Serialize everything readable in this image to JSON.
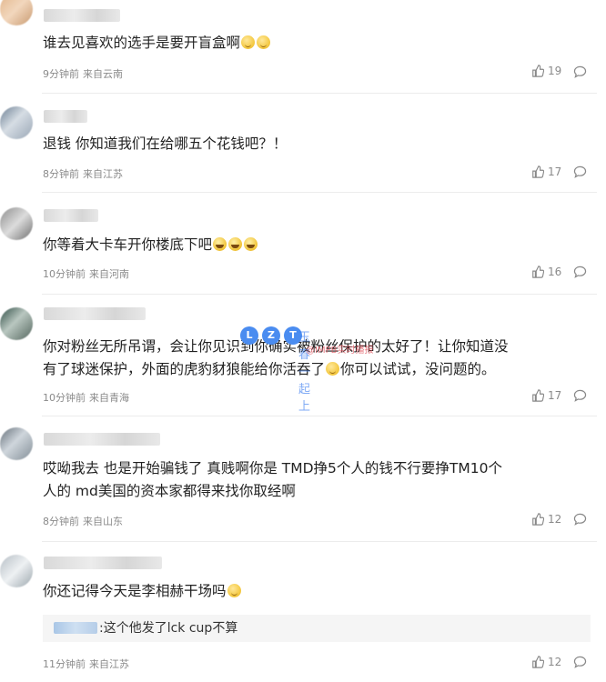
{
  "comments": [
    {
      "text": "谁去见喜欢的选手是要开盲盒啊",
      "emojis": [
        "smile",
        "smile"
      ],
      "time": "9分钟前",
      "location": "来自云南",
      "likes": "19"
    },
    {
      "text": "退钱 你知道我们在给哪五个花钱吧？！",
      "emojis": [],
      "time": "8分钟前",
      "location": "来自江苏",
      "likes": "17"
    },
    {
      "text": "你等着大卡车开你楼底下吧",
      "emojis": [
        "laugh",
        "laugh",
        "laugh"
      ],
      "time": "10分钟前",
      "location": "来自河南",
      "likes": "16"
    },
    {
      "text_line1": "你对粉丝无所吊谓，会让你见识到你确实被粉丝保护的太好了！让你知道没",
      "text_line2_a": "有了球迷保护，外面的虎豹豺狼能给你活吞了",
      "text_line2_b": "你可以试试，没问题的。",
      "time": "10分钟前",
      "location": "来自青海",
      "likes": "17"
    },
    {
      "text_line1": "哎呦我去 也是开始骗钱了 真贱啊你是 TMD挣5个人的钱不行要挣TM10个",
      "text_line2": "人的 md美国的资本家都得来找你取经啊",
      "time": "8分钟前",
      "location": "来自山东",
      "likes": "12"
    },
    {
      "text": "你还记得今天是李相赫干场吗",
      "sub_reply": ":这个他发了lck cup不算",
      "time": "11分钟前",
      "location": "来自江苏",
      "likes": "12"
    }
  ],
  "watermark": {
    "badge1": "L",
    "badge2": "Z",
    "badge3": "T",
    "text": "玉春一起上",
    "sub": "@IMPB实时播报"
  },
  "icons": {
    "like": "thumbs-up-icon",
    "reply": "comment-bubble-icon"
  },
  "colors": {
    "meta": "#8a8a8a",
    "text": "#222222",
    "divider": "#ececec",
    "subreply_bg": "#f5f5f5"
  }
}
